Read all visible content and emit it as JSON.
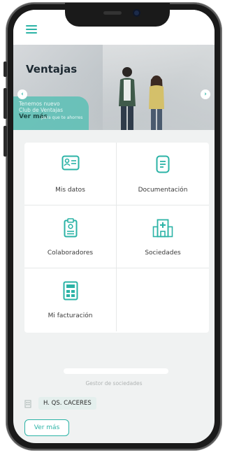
{
  "app": {
    "title": ""
  },
  "banner": {
    "title": "Ventajas",
    "promo_lines": [
      "Tenemos nuevo",
      "Club de Ventajas"
    ],
    "promo_more": "Ver más",
    "promo_sub": "para que te ahorres"
  },
  "tiles": [
    {
      "label": "Mis datos",
      "icon": "id-card-icon"
    },
    {
      "label": "Documentación",
      "icon": "document-icon"
    },
    {
      "label": "Colaboradores",
      "icon": "clipboard-badge-icon"
    },
    {
      "label": "Sociedades",
      "icon": "hospital-building-icon"
    },
    {
      "label": "Mi facturación",
      "icon": "calculator-icon"
    }
  ],
  "footer": {
    "section_label": "Gestor de sociedades",
    "company": "H. QS. CACERES",
    "more_label": "Ver más"
  },
  "colors": {
    "accent": "#2bb3a6",
    "accent_light": "#5bbfb5",
    "background": "#f0f2f2",
    "badge": "#e4efed"
  }
}
